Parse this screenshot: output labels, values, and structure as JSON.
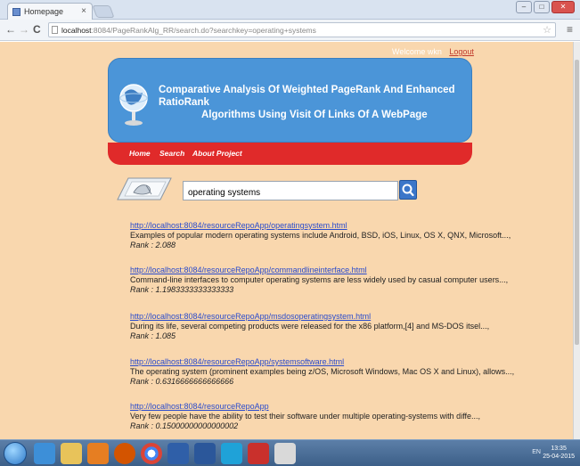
{
  "browser": {
    "tab_title": "Homepage",
    "tab_close": "×",
    "url_host": "localhost",
    "url_rest": ":8084/PageRankAlg_RR/search.do?searchkey=operating+systems",
    "nav_back": "←",
    "nav_forward": "→",
    "nav_reload": "C",
    "star": "☆",
    "menu": "≡",
    "window_buttons": [
      "–",
      "□",
      "✕"
    ]
  },
  "header": {
    "welcome": "Welcome wkn",
    "logout": "Logout",
    "title_line1": "Comparative Analysis Of Weighted PageRank And Enhanced RatioRank",
    "title_line2": "Algorithms Using Visit Of Links Of A WebPage"
  },
  "menu": {
    "items": [
      "Home",
      "Search",
      "About Project"
    ]
  },
  "search": {
    "value": "operating systems"
  },
  "results": [
    {
      "url": "http://localhost:8084/resourceRepoApp/operatingsystem.html",
      "desc": "Examples of popular modern operating systems include Android, BSD, iOS, Linux, OS X, QNX, Microsoft...,",
      "rank": "Rank : 2.088"
    },
    {
      "url": "http://localhost:8084/resourceRepoApp/commandlineinterface.html",
      "desc": "Command-line interfaces to computer operating systems are less widely used by casual computer users...,",
      "rank": "Rank : 1.1983333333333333"
    },
    {
      "url": "http://localhost:8084/resourceRepoApp/msdosoperatingsystem.html",
      "desc": "During its life, several competing products were released for the x86 platform,[4] and MS-DOS itsel...,",
      "rank": "Rank : 1.085"
    },
    {
      "url": "http://localhost:8084/resourceRepoApp/systemsoftware.html",
      "desc": "The operating system (prominent examples being z/OS, Microsoft Windows, Mac OS X and Linux), allows...,",
      "rank": "Rank : 0.6316666666666666"
    },
    {
      "url": "http://localhost:8084/resourceRepoApp",
      "desc": "Very few people have the ability to test their software under multiple operating-systems with diffe...,",
      "rank": "Rank : 0.15000000000000002"
    }
  ],
  "taskbar": {
    "tray_text": "EN",
    "time": "13:35",
    "date": "25-04-2015"
  },
  "colors": {
    "page_bg": "#f9d7ae",
    "banner": "#4b95d8",
    "menubar": "#e02a2a",
    "link": "#2a4bcc"
  }
}
